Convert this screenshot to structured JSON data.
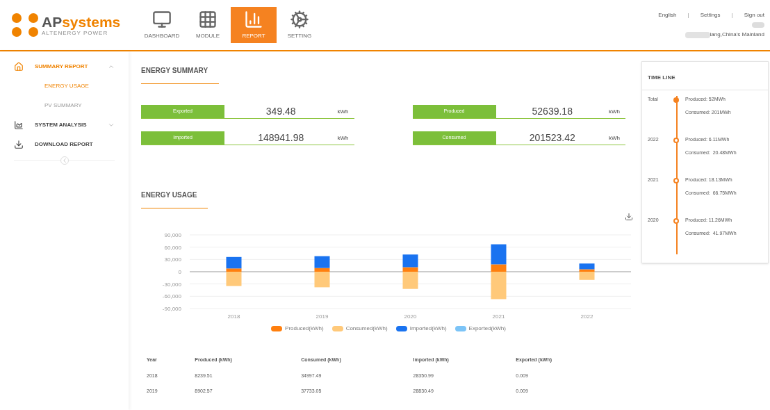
{
  "logo": {
    "brand_dark": "AP",
    "brand_orange": "systems",
    "tagline": "ALTENERGY POWER"
  },
  "nav_tabs": [
    {
      "label": "DASHBOARD",
      "kind": "monitor",
      "selected": false
    },
    {
      "label": "MODULE",
      "kind": "grid",
      "selected": false
    },
    {
      "label": "REPORT",
      "kind": "chart",
      "selected": true
    },
    {
      "label": "SETTING",
      "kind": "gears",
      "selected": false
    }
  ],
  "top_links": [
    {
      "kind": "link",
      "text": "English"
    },
    {
      "kind": "separator",
      "text": "|"
    },
    {
      "kind": "link",
      "text": "Settings"
    },
    {
      "kind": "separator",
      "text": "|"
    },
    {
      "kind": "link",
      "text": "Sign out"
    }
  ],
  "user": {
    "location": "iang,China's Mainland"
  },
  "sidebar": {
    "items": [
      {
        "label": "SUMMARY REPORT",
        "kind": "home",
        "expanded": true,
        "selected": true,
        "children": [
          {
            "label": "ENERGY USAGE",
            "selected": true
          },
          {
            "label": "PV SUMMARY",
            "selected": false
          }
        ]
      },
      {
        "label": "SYSTEM ANALYSIS",
        "kind": "analysis",
        "expanded": false,
        "selected": false
      },
      {
        "label": "DOWNLOAD REPORT",
        "kind": "download",
        "selected": false
      }
    ]
  },
  "energy_summary": {
    "title": "ENERGY SUMMARY",
    "cards": [
      {
        "label": "Exported",
        "value": "349.48",
        "unit": "kWh"
      },
      {
        "label": "Produced",
        "value": "52639.18",
        "unit": "kWh"
      },
      {
        "label": "Imported",
        "value": "148941.98",
        "unit": "kWh"
      },
      {
        "label": "Consumed",
        "value": "201523.42",
        "unit": "kWh"
      }
    ]
  },
  "energy_usage": {
    "title": "ENERGY USAGE",
    "chart_data": {
      "type": "bar",
      "stacked": true,
      "grid": true,
      "categories": [
        "2018",
        "2019",
        "2020",
        "2021",
        "2022"
      ],
      "ylim": [
        -90000,
        90000
      ],
      "yticks": [
        {
          "value": 90000,
          "label": "90,000"
        },
        {
          "value": 60000,
          "label": "60,000"
        },
        {
          "value": 30000,
          "label": "30,000"
        },
        {
          "value": 0,
          "label": "0"
        },
        {
          "value": -30000,
          "label": "-30,000"
        },
        {
          "value": -60000,
          "label": "-60,000"
        },
        {
          "value": -90000,
          "label": "-90,000"
        }
      ],
      "series": [
        {
          "name": "Produced(kWh)",
          "color": "#ff7f0e",
          "values": [
            8000,
            9000,
            11000,
            18000,
            6000
          ]
        },
        {
          "name": "Consumed(kWh)",
          "color": "#ffc97a",
          "values": [
            -35000,
            -38000,
            -42000,
            -67000,
            -20000
          ]
        },
        {
          "name": "Imported(kWh)",
          "color": "#1a73f0",
          "values": [
            28000,
            29000,
            31000,
            49000,
            14000
          ]
        },
        {
          "name": "Exported(kWh)",
          "color": "#7cc4f7",
          "values": [
            0,
            0,
            0,
            0,
            0
          ]
        }
      ]
    },
    "table": {
      "columns": [
        "Year",
        "Produced (kWh)",
        "Consumed (kWh)",
        "Imported (kWh)",
        "Exported (kWh)"
      ],
      "rows": [
        [
          "2018",
          "8239.51",
          "34997.49",
          "28350.99",
          "0.009"
        ],
        [
          "2019",
          "8902.57",
          "37733.05",
          "28830.49",
          "0.009"
        ]
      ]
    }
  },
  "timeline": {
    "title": "TIME LINE",
    "entries": [
      {
        "label": "Total",
        "kind": "total",
        "produced": "Produced: 52MWh",
        "consumed": "Consumed: 201MWh"
      },
      {
        "label": "2022",
        "kind": "year",
        "produced": "Produced: 6.11MWh",
        "consumed": "Consumed:  20.48MWh"
      },
      {
        "label": "2021",
        "kind": "year",
        "produced": "Produced: 18.13MWh",
        "consumed": "Consumed:  66.75MWh"
      },
      {
        "label": "2020",
        "kind": "year",
        "produced": "Produced: 11.26MWh",
        "consumed": "Consumed:  41.97MWh"
      }
    ]
  }
}
